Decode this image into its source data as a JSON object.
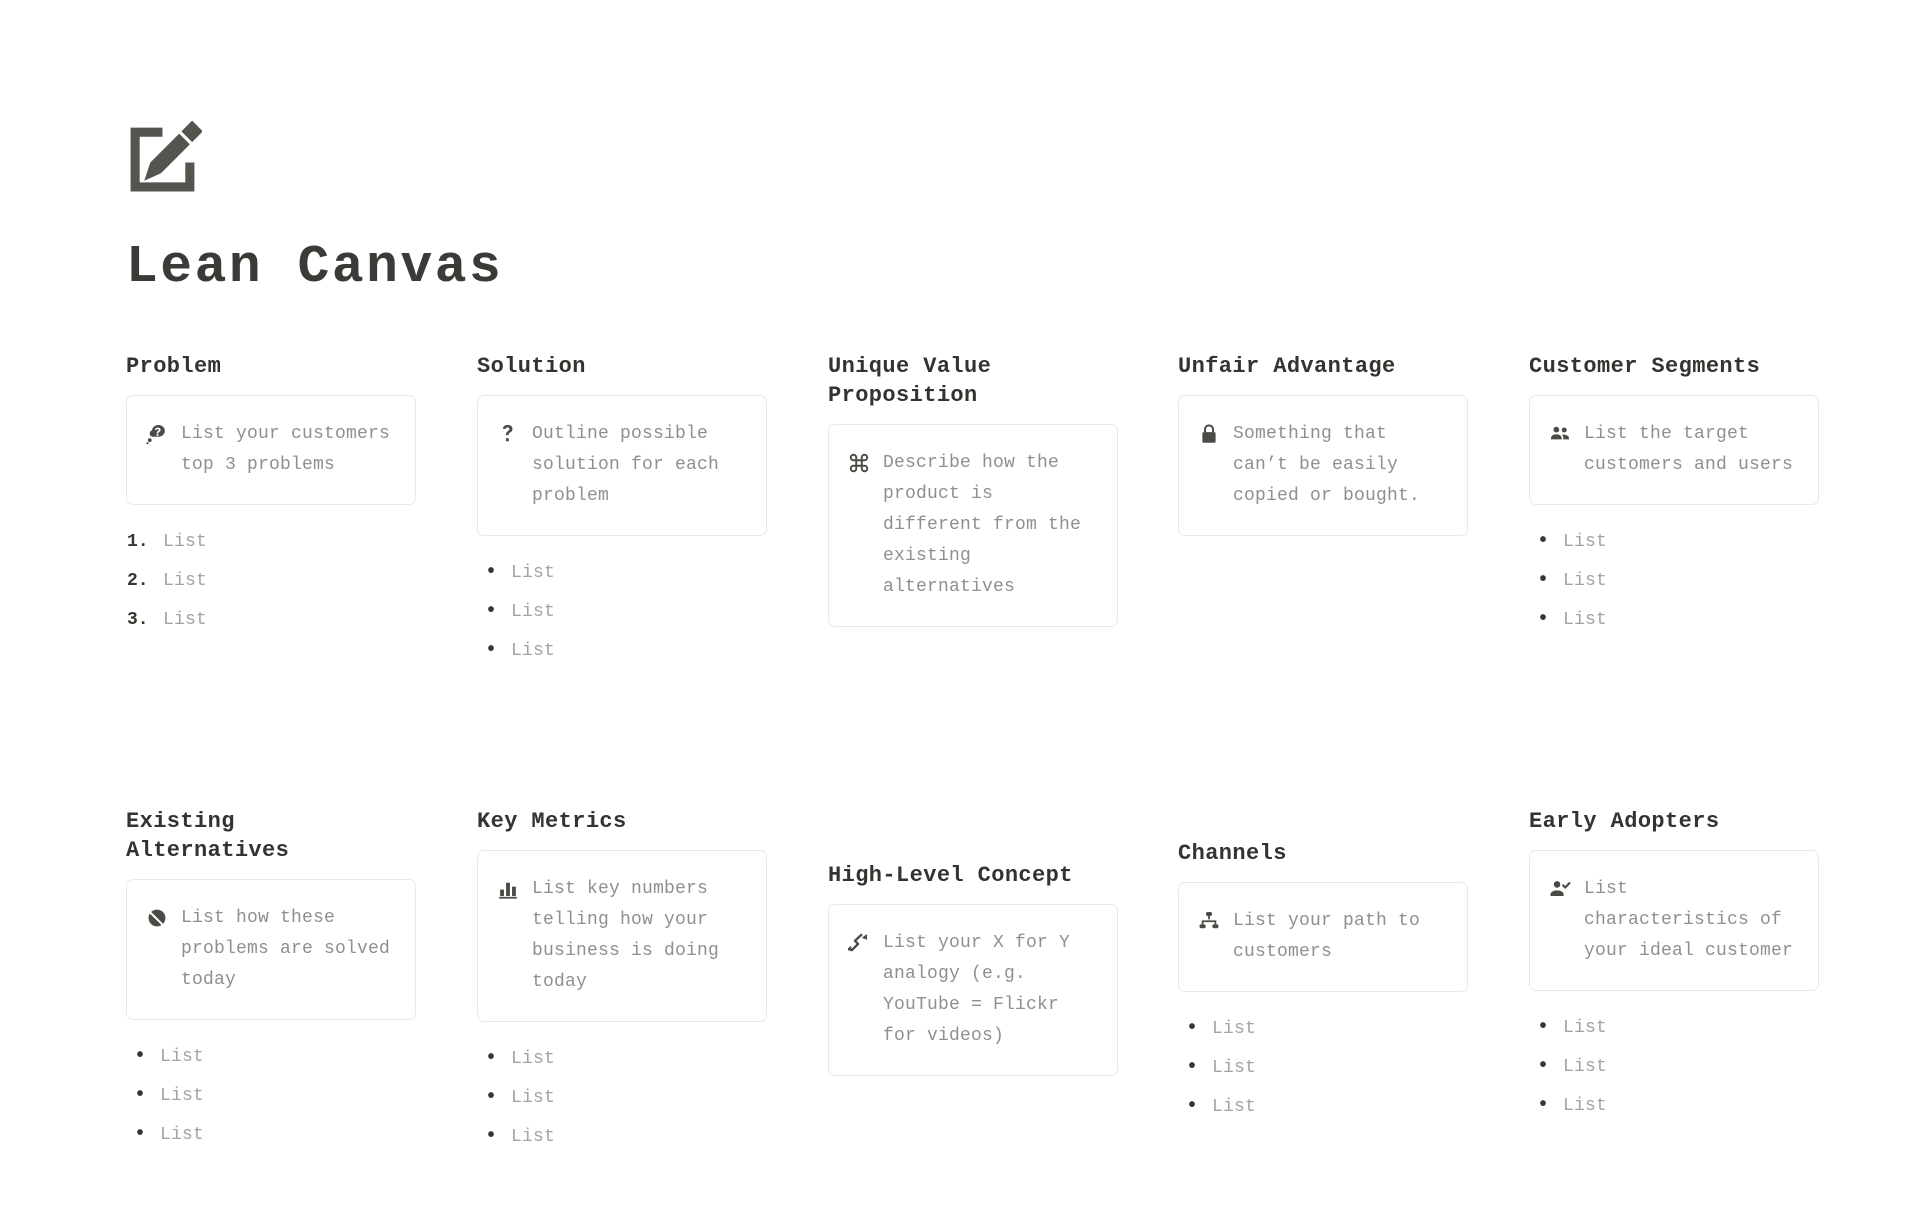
{
  "header": {
    "icon": "edit-square-pencil-icon",
    "title": "Lean Canvas"
  },
  "blocks": {
    "problem": {
      "title": "Problem",
      "icon": "thought-bubble-question-icon",
      "hint": "List your customers top 3 problems",
      "list_style": "ordered",
      "items": [
        "List",
        "List",
        "List"
      ],
      "markers": [
        "1.",
        "2.",
        "3."
      ]
    },
    "solution": {
      "title": "Solution",
      "icon": "question-mark-icon",
      "hint": "Outline possible solution for each problem",
      "list_style": "bulleted",
      "items": [
        "List",
        "List",
        "List"
      ]
    },
    "uvp": {
      "title": "Unique Value\nProposition",
      "icon": "command-loop-icon",
      "hint": "Describe how the product is different from the existing alternatives",
      "list_style": "none",
      "items": []
    },
    "unfair_advantage": {
      "title": "Unfair Advantage",
      "icon": "lock-icon",
      "hint": "Something that can’t be easily copied or bought.",
      "list_style": "none",
      "items": []
    },
    "customer_segments": {
      "title": "Customer Segments",
      "icon": "users-group-icon",
      "hint": "List the target customers and users",
      "list_style": "bulleted",
      "items": [
        "List",
        "List",
        "List"
      ]
    },
    "existing_alternatives": {
      "title": "Existing\nAlternatives",
      "icon": "prohibited-circle-slash-icon",
      "hint": "List how these problems are solved today",
      "list_style": "bulleted",
      "items": [
        "List",
        "List",
        "List"
      ]
    },
    "key_metrics": {
      "title": "Key Metrics",
      "icon": "bar-chart-icon",
      "hint": "List key numbers telling how your business is doing today",
      "list_style": "bulleted",
      "items": [
        "List",
        "List",
        "List"
      ]
    },
    "high_level_concept": {
      "title": "High-Level Concept",
      "icon": "zigzag-arrow-icon",
      "hint": "List your X for Y analogy (e.g. YouTube = Flickr for videos)",
      "list_style": "none",
      "items": []
    },
    "channels": {
      "title": "Channels",
      "icon": "sitemap-hierarchy-icon",
      "hint": "List your path to customers",
      "list_style": "bulleted",
      "items": [
        "List",
        "List",
        "List"
      ]
    },
    "early_adopters": {
      "title": "Early Adopters",
      "icon": "user-check-icon",
      "hint": "List characteristics of your ideal customer",
      "list_style": "bulleted",
      "items": [
        "List",
        "List",
        "List"
      ]
    }
  },
  "colors": {
    "background": "#ffffff",
    "title_text": "#3a3a36",
    "heading_text": "#33332f",
    "hint_text": "#8f8f8f",
    "item_text": "#a3a3a3",
    "card_border": "#e9e9e7",
    "icon": "#4b4b46",
    "marker": "#36362f"
  }
}
